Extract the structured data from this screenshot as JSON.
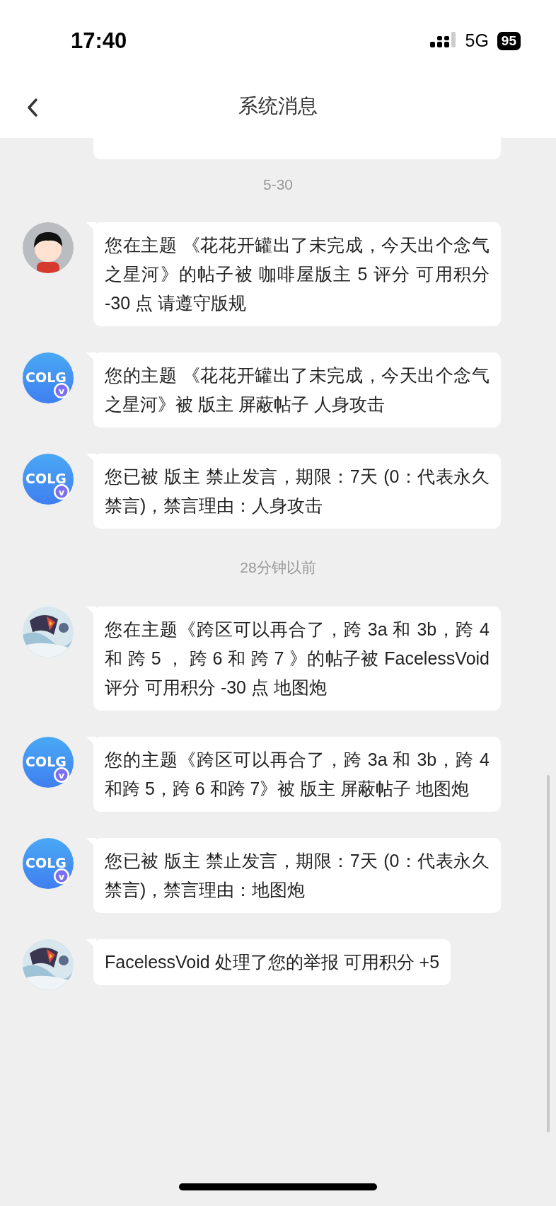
{
  "status_bar": {
    "time": "17:40",
    "network": "5G",
    "battery": "95"
  },
  "header": {
    "title": "系统消息"
  },
  "messages": [
    {
      "kind": "date",
      "text": "5-30"
    },
    {
      "kind": "message",
      "avatar": {
        "kind": "cartoon"
      },
      "text": "您在主题 《花花开罐出了未完成，今天出个念气之星河》的帖子被 咖啡屋版主 5 评分 可用积分 -30 点 请遵守版规"
    },
    {
      "kind": "message",
      "avatar": {
        "kind": "logo",
        "logo_text": "COLG",
        "badge": "v"
      },
      "text": "您的主题 《花花开罐出了未完成，今天出个念气之星河》被 版主 屏蔽帖子 人身攻击"
    },
    {
      "kind": "message",
      "avatar": {
        "kind": "logo",
        "logo_text": "COLG",
        "badge": "v"
      },
      "text": "您已被 版主 禁止发言，期限：7天 (0：代表永久禁言)，禁言理由：人身攻击"
    },
    {
      "kind": "date",
      "text": "28分钟以前"
    },
    {
      "kind": "message",
      "text": "您在主题《跨区可以再合了，跨 3a 和 3b，跨 4 和 跨 5 ， 跨 6 和 跨 7 》的帖子被 FacelessVoid 评分 可用积分 -30 点 地图炮"
    },
    {
      "kind": "message",
      "avatar": {
        "kind": "logo",
        "logo_text": "COLG",
        "badge": "v"
      },
      "text": "您的主题《跨区可以再合了，跨 3a 和 3b，跨 4 和跨 5，跨 6 和跨 7》被 版主 屏蔽帖子 地图炮"
    },
    {
      "kind": "message",
      "avatar": {
        "kind": "logo",
        "logo_text": "COLG",
        "badge": "v"
      },
      "text": "您已被 版主 禁止发言，期限：7天 (0：代表永久禁言)，禁言理由：地图炮"
    },
    {
      "kind": "message",
      "text": "FacelessVoid 处理了您的举报 可用积分 +5"
    }
  ]
}
